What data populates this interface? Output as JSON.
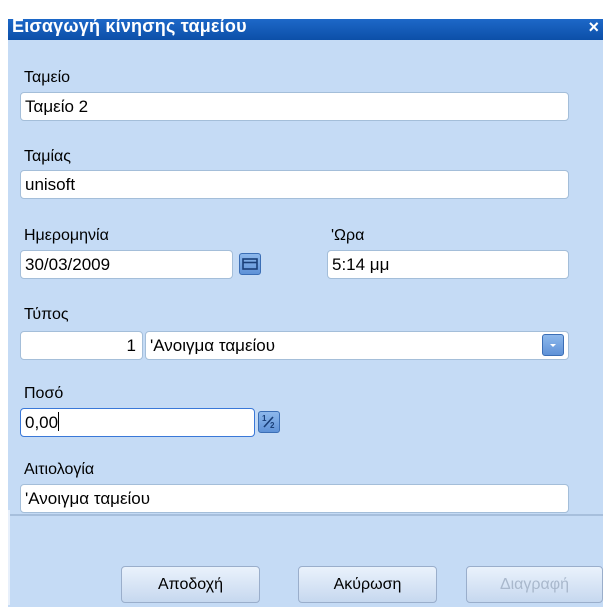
{
  "dialog": {
    "title": "Εισαγωγή κίνησης ταμείου",
    "close_symbol": "×"
  },
  "form": {
    "cashbox": {
      "label": "Ταμείο",
      "value": "Ταμείο 2"
    },
    "cashier": {
      "label": "Ταμίας",
      "value": "unisoft"
    },
    "date": {
      "label": "Ημερομηνία",
      "value": "30/03/2009"
    },
    "time": {
      "label": "'Ωρα",
      "value": "5:14 μμ"
    },
    "type": {
      "label": "Τύπος",
      "code": "1",
      "value": "'Ανοιγμα ταμείου"
    },
    "amount": {
      "label": "Ποσό",
      "value": "0,00"
    },
    "reason": {
      "label": "Αιτιολογία",
      "value": "'Ανοιγμα ταμείου"
    }
  },
  "buttons": {
    "accept": "Αποδοχή",
    "cancel": "Ακύρωση",
    "delete": "Διαγραφή"
  },
  "icons": {
    "calendar": "calendar-icon",
    "calculator": "calculator-icon",
    "dropdown": "chevron-down-icon",
    "close": "close-icon"
  },
  "colors": {
    "titlebar": "#1d68c8",
    "panel": "#c5dbf5",
    "accent_button": "#5f92d8"
  }
}
